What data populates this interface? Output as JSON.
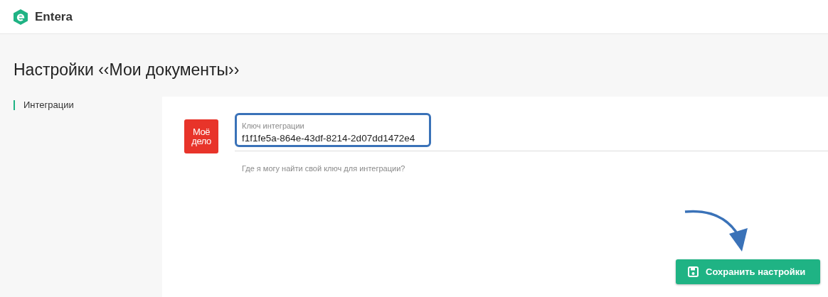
{
  "header": {
    "brand": "Entera"
  },
  "page": {
    "title": "Настройки ‹‹Мои документы››"
  },
  "sidebar": {
    "items": [
      {
        "label": "Интеграции",
        "selected": true
      }
    ]
  },
  "integration": {
    "logo_lines": [
      "Моё",
      "дело"
    ],
    "field": {
      "label": "Ключ интеграции",
      "value": "f1f1fe5a-864e-43df-8214-2d07dd1472e4",
      "highlighted": true
    },
    "help_link": "Где я могу найти свой ключ для интеграции?"
  },
  "save_button": {
    "label": "Сохранить настройки"
  }
}
